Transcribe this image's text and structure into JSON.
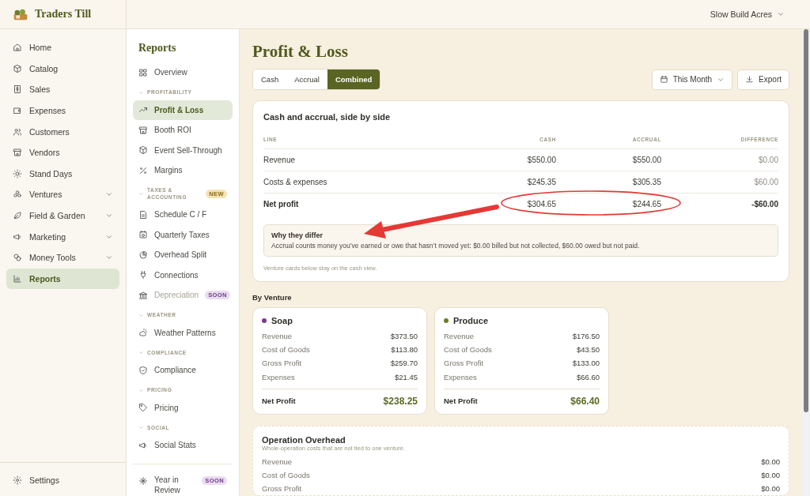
{
  "app": {
    "name": "Traders Till"
  },
  "account": {
    "name": "Slow Build Acres"
  },
  "nav": [
    {
      "label": "Home",
      "expandable": false,
      "selected": false
    },
    {
      "label": "Catalog",
      "expandable": false,
      "selected": false
    },
    {
      "label": "Sales",
      "expandable": false,
      "selected": false
    },
    {
      "label": "Expenses",
      "expandable": false,
      "selected": false
    },
    {
      "label": "Customers",
      "expandable": false,
      "selected": false
    },
    {
      "label": "Vendors",
      "expandable": false,
      "selected": false
    },
    {
      "label": "Stand Days",
      "expandable": false,
      "selected": false
    },
    {
      "label": "Ventures",
      "expandable": true,
      "selected": false
    },
    {
      "label": "Field & Garden",
      "expandable": true,
      "selected": false
    },
    {
      "label": "Marketing",
      "expandable": true,
      "selected": false
    },
    {
      "label": "Money Tools",
      "expandable": true,
      "selected": false
    },
    {
      "label": "Reports",
      "expandable": false,
      "selected": true
    }
  ],
  "settings": {
    "label": "Settings"
  },
  "subnav": {
    "title": "Reports",
    "items": [
      {
        "kind": "link",
        "label": "Overview",
        "selected": false,
        "disabled": false
      },
      {
        "kind": "section",
        "label": "PROFITABILITY"
      },
      {
        "kind": "link",
        "label": "Profit & Loss",
        "selected": true,
        "disabled": false
      },
      {
        "kind": "link",
        "label": "Booth ROI",
        "selected": false,
        "disabled": false
      },
      {
        "kind": "link",
        "label": "Event Sell-Through",
        "selected": false,
        "disabled": false
      },
      {
        "kind": "link",
        "label": "Margins",
        "selected": false,
        "disabled": false
      },
      {
        "kind": "section",
        "label": "TAXES & ACCOUNTING",
        "badge": "NEW"
      },
      {
        "kind": "link",
        "label": "Schedule C / F",
        "selected": false,
        "disabled": false
      },
      {
        "kind": "link",
        "label": "Quarterly Taxes",
        "selected": false,
        "disabled": false
      },
      {
        "kind": "link",
        "label": "Overhead Split",
        "selected": false,
        "disabled": false
      },
      {
        "kind": "link",
        "label": "Connections",
        "selected": false,
        "disabled": false
      },
      {
        "kind": "link",
        "label": "Depreciation",
        "selected": false,
        "disabled": true,
        "badge": "SOON"
      },
      {
        "kind": "section",
        "label": "WEATHER"
      },
      {
        "kind": "link",
        "label": "Weather Patterns",
        "selected": false,
        "disabled": false
      },
      {
        "kind": "section",
        "label": "COMPLIANCE"
      },
      {
        "kind": "link",
        "label": "Compliance",
        "selected": false,
        "disabled": false
      },
      {
        "kind": "section",
        "label": "PRICING"
      },
      {
        "kind": "link",
        "label": "Pricing",
        "selected": false,
        "disabled": false
      },
      {
        "kind": "section",
        "label": "SOCIAL"
      },
      {
        "kind": "link",
        "label": "Social Stats",
        "selected": false,
        "disabled": false
      }
    ],
    "footer_items": [
      {
        "label": "Year in Review",
        "selected": false,
        "disabled": false,
        "badge": "SOON"
      }
    ]
  },
  "page": {
    "title": "Profit & Loss",
    "tabs": [
      {
        "label": "Cash",
        "selected": false
      },
      {
        "label": "Accrual",
        "selected": false
      },
      {
        "label": "Combined",
        "selected": true
      }
    ],
    "period": "This Month",
    "export": "Export"
  },
  "comparison": {
    "title": "Cash and accrual, side by side",
    "columns": [
      "LINE",
      "CASH",
      "ACCRUAL",
      "DIFFERENCE"
    ],
    "rows": [
      {
        "line": "Revenue",
        "cash": "$550.00",
        "accrual": "$550.00",
        "difference": "$0.00",
        "total": false
      },
      {
        "line": "Costs & expenses",
        "cash": "$245.35",
        "accrual": "$305.35",
        "difference": "$60.00",
        "total": false
      },
      {
        "line": "Net profit",
        "cash": "$304.65",
        "accrual": "$244.65",
        "difference": "-$60.00",
        "total": true
      }
    ],
    "note": {
      "title": "Why they differ",
      "text": "Accrual counts money you’ve earned or owe that hasn’t moved yet: $0.00 billed but not collected, $60.00 owed but not paid."
    },
    "footnote": "Venture cards below stay on the cash view."
  },
  "ventures": {
    "title": "By Venture",
    "items": [
      {
        "name": "Soap",
        "color": "#7b3a8c",
        "rows": [
          {
            "label": "Revenue",
            "value": "$373.50"
          },
          {
            "label": "Cost of Goods",
            "value": "$113.80"
          },
          {
            "label": "Gross Profit",
            "value": "$259.70"
          },
          {
            "label": "Expenses",
            "value": "$21.45"
          }
        ],
        "net_label": "Net Profit",
        "net_value": "$238.25"
      },
      {
        "name": "Produce",
        "color": "#6b7d2a",
        "rows": [
          {
            "label": "Revenue",
            "value": "$176.50"
          },
          {
            "label": "Cost of Goods",
            "value": "$43.50"
          },
          {
            "label": "Gross Profit",
            "value": "$133.00"
          },
          {
            "label": "Expenses",
            "value": "$66.60"
          }
        ],
        "net_label": "Net Profit",
        "net_value": "$66.40"
      }
    ]
  },
  "overhead": {
    "title": "Operation Overhead",
    "subtitle": "Whole-operation costs that are not tied to one venture.",
    "rows": [
      {
        "label": "Revenue",
        "value": "$0.00"
      },
      {
        "label": "Cost of Goods",
        "value": "$0.00"
      },
      {
        "label": "Gross Profit",
        "value": "$0.00"
      }
    ]
  }
}
